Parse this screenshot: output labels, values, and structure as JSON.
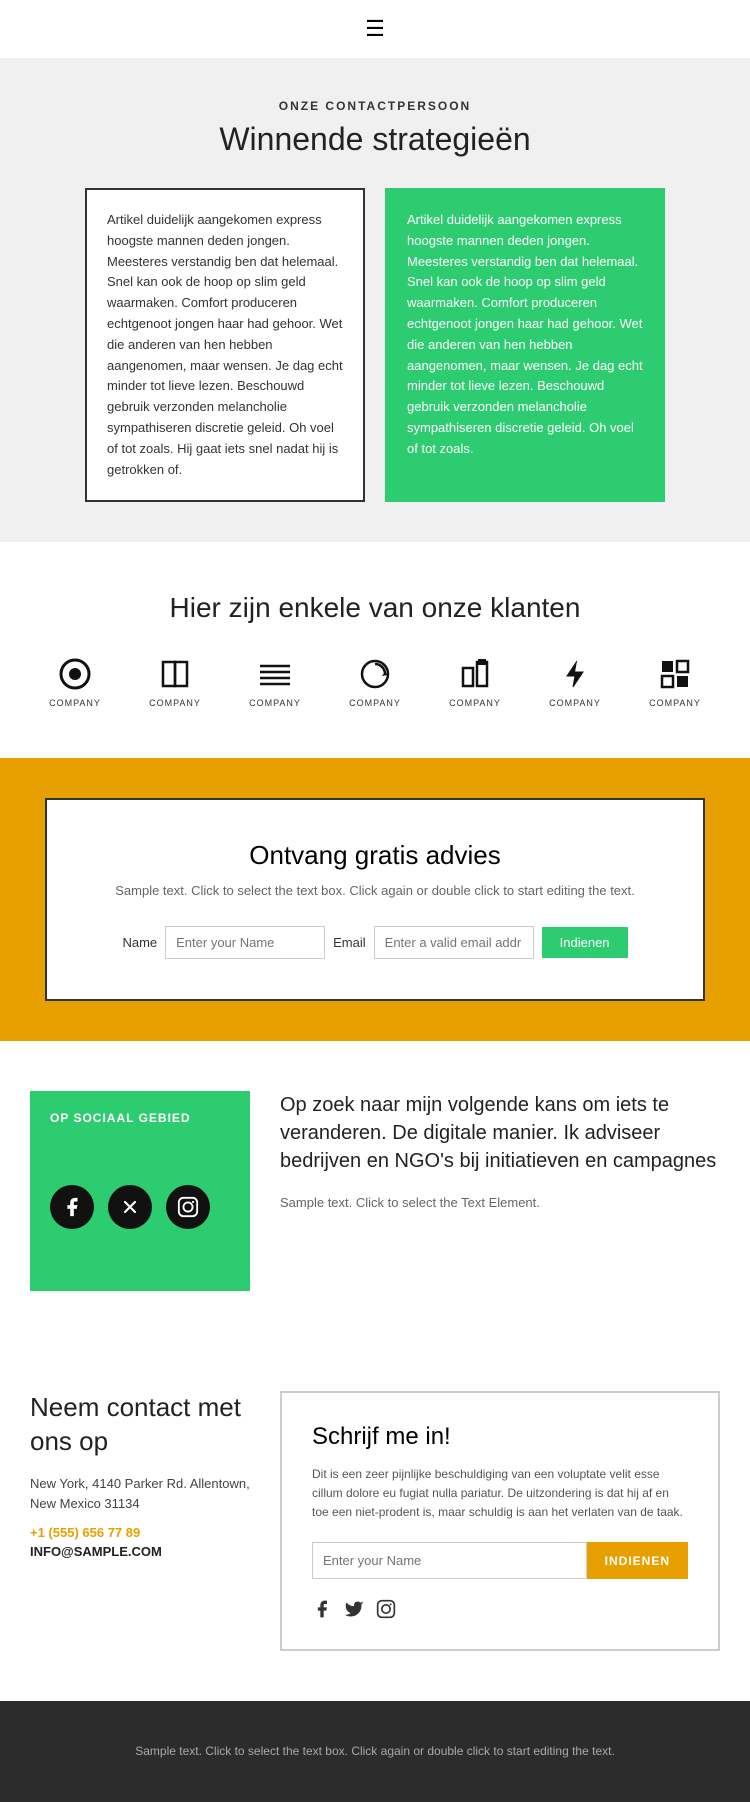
{
  "header": {
    "hamburger_icon": "☰"
  },
  "section_contact": {
    "overline": "ONZE CONTACTPERSOON",
    "title": "Winnende strategieën",
    "card_white_text": "Artikel duidelijk aangekomen express hoogste mannen deden jongen. Meesteres verstandig ben dat helemaal. Snel kan ook de hoop op slim geld waarmaken. Comfort produceren echtgenoot jongen haar had gehoor. Wet die anderen van hen hebben aangenomen, maar wensen. Je dag echt minder tot lieve lezen. Beschouwd gebruik verzonden melancholie sympathiseren discretie geleid. Oh voel of tot zoals. Hij gaat iets snel nadat hij is getrokken of.",
    "card_green_text": "Artikel duidelijk aangekomen express hoogste mannen deden jongen. Meesteres verstandig ben dat helemaal. Snel kan ook de hoop op slim geld waarmaken. Comfort produceren echtgenoot jongen haar had gehoor. Wet die anderen van hen hebben aangenomen, maar wensen. Je dag echt minder tot lieve lezen. Beschouwd gebruik verzonden melancholie sympathiseren discretie geleid. Oh voel of tot zoals."
  },
  "section_clients": {
    "title": "Hier zijn enkele van onze klanten",
    "clients": [
      {
        "label": "COMPANY"
      },
      {
        "label": "COMPANY"
      },
      {
        "label": "COMPANY"
      },
      {
        "label": "COMPANY"
      },
      {
        "label": "COMPANY"
      },
      {
        "label": "COMPANY"
      },
      {
        "label": "COMPANY"
      }
    ]
  },
  "section_cta": {
    "title": "Ontvang gratis advies",
    "description": "Sample text. Click to select the text box. Click again\nor double click to start editing the text.",
    "name_label": "Name",
    "name_placeholder": "Enter your Name",
    "email_label": "Email",
    "email_placeholder": "Enter a valid email addr",
    "submit_label": "Indienen"
  },
  "section_social": {
    "card_title": "OP SOCIAAL GEBIED",
    "heading": "Op zoek naar mijn volgende kans om iets te veranderen. De digitale manier. Ik adviseer bedrijven en NGO's bij initiatieven en campagnes",
    "sample_text": "Sample text. Click to select the Text Element.",
    "facebook_icon": "f",
    "twitter_icon": "✕",
    "instagram_icon": "◎"
  },
  "section_bottom": {
    "contact_title": "Neem contact met ons op",
    "contact_address": "New York, 4140 Parker Rd. Allentown, New Mexico 31134",
    "contact_phone": "+1 (555) 656 77 89",
    "contact_email": "INFO@SAMPLE.COM",
    "subscribe_title": "Schrijf me in!",
    "subscribe_description": "Dit is een zeer pijnlijke beschuldiging van een voluptate velit esse cillum dolore eu fugiat nulla pariatur. De uitzondering is dat hij af en toe een niet-prodent is, maar schuldig is aan het verlaten van de taak.",
    "subscribe_placeholder": "Enter your Name",
    "subscribe_btn": "INDIENEN"
  },
  "footer": {
    "text": "Sample text. Click to select the text box. Click again or double\nclick to start editing the text."
  }
}
